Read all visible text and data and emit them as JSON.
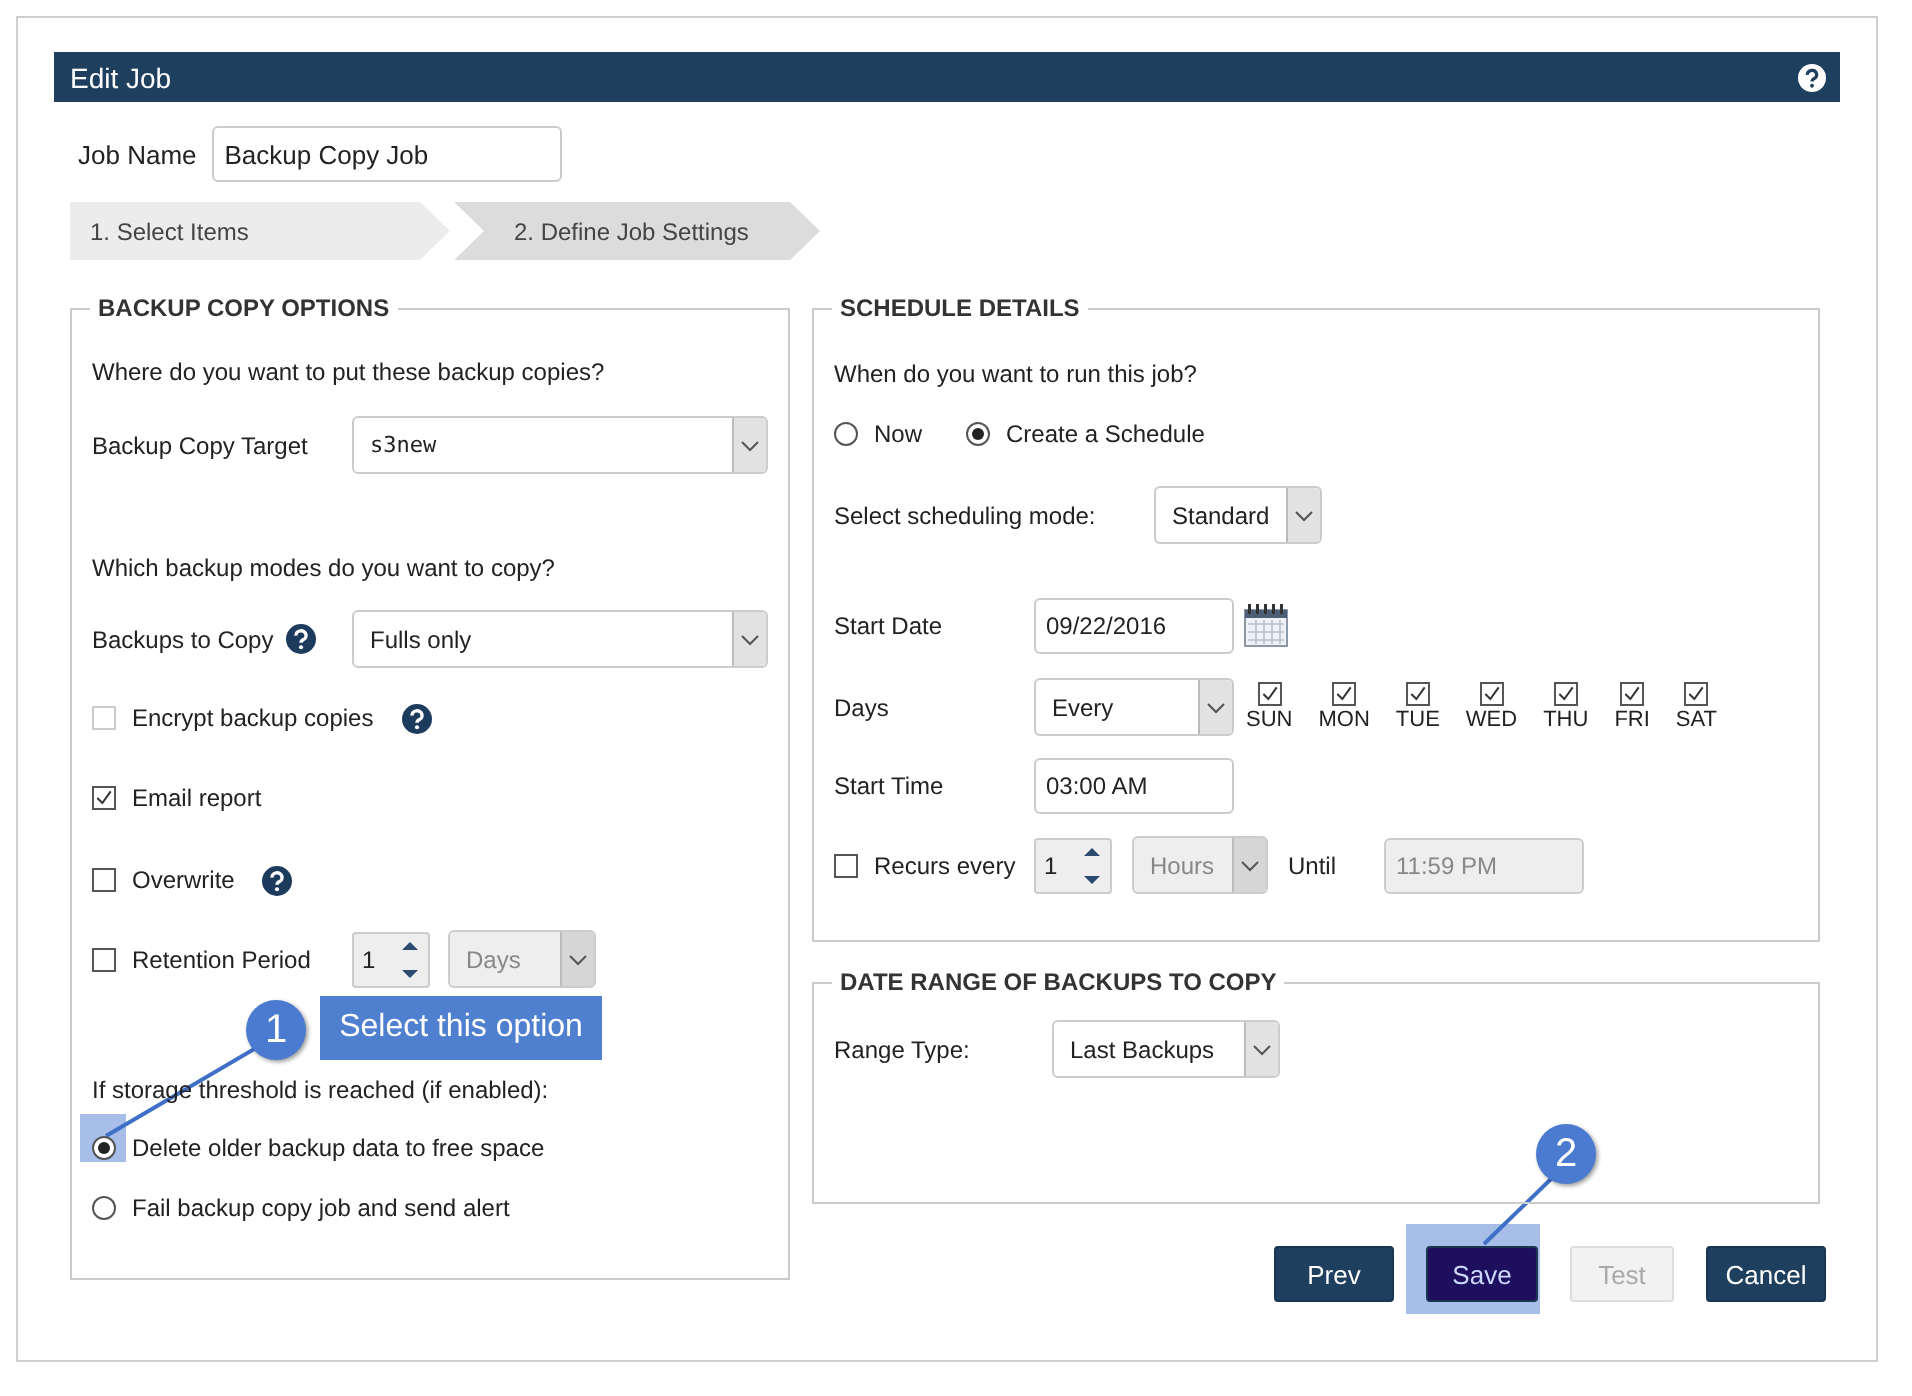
{
  "dialog": {
    "title": "Edit Job"
  },
  "job_name": {
    "label": "Job Name",
    "value": "Backup Copy Job"
  },
  "steps": [
    {
      "label": "1. Select Items",
      "selected": false
    },
    {
      "label": "2. Define Job Settings",
      "selected": true
    }
  ],
  "backup_copy_options": {
    "title": "BACKUP COPY OPTIONS",
    "target_question": "Where do you want to put these backup copies?",
    "target": {
      "label": "Backup Copy Target",
      "value": "s3new"
    },
    "modes_question": "Which backup modes do you want to copy?",
    "backups_to_copy": {
      "label": "Backups to Copy",
      "value": "Fulls only",
      "help": true
    },
    "options": [
      {
        "kind": "checkbox",
        "label": "Encrypt backup copies",
        "checked": false,
        "disabled": true,
        "help": true
      },
      {
        "kind": "checkbox",
        "label": "Email report",
        "checked": true,
        "disabled": false,
        "help": false
      },
      {
        "kind": "checkbox",
        "label": "Overwrite",
        "checked": false,
        "disabled": false,
        "help": true
      },
      {
        "kind": "retention",
        "label": "Retention Period",
        "checked": false,
        "disabled": false,
        "help": false,
        "count": "1",
        "unit": "Days"
      }
    ],
    "threshold_label": "If storage threshold is reached (if enabled):",
    "threshold_choices": [
      {
        "label": "Delete older backup data to free space",
        "selected": true
      },
      {
        "label": "Fail backup copy job and send alert",
        "selected": false
      }
    ]
  },
  "schedule": {
    "title": "SCHEDULE DETAILS",
    "question": "When do you want to run this job?",
    "run": [
      {
        "label": "Now",
        "selected": false
      },
      {
        "label": "Create a Schedule",
        "selected": true
      }
    ],
    "mode": {
      "label": "Select scheduling mode:",
      "value": "Standard"
    },
    "start_date": {
      "label": "Start Date",
      "value": "09/22/2016"
    },
    "days": {
      "label": "Days",
      "value": "Every",
      "weekdays": [
        {
          "label": "SUN",
          "checked": true
        },
        {
          "label": "MON",
          "checked": true
        },
        {
          "label": "TUE",
          "checked": true
        },
        {
          "label": "WED",
          "checked": true
        },
        {
          "label": "THU",
          "checked": true
        },
        {
          "label": "FRI",
          "checked": true
        },
        {
          "label": "SAT",
          "checked": true
        }
      ]
    },
    "start_time": {
      "label": "Start Time",
      "value": "03:00 AM"
    },
    "recurs": {
      "label": "Recurs every",
      "checked": false,
      "count": "1",
      "unit": "Hours",
      "until_label": "Until",
      "until": "11:59 PM"
    }
  },
  "date_range": {
    "title": "DATE RANGE OF BACKUPS TO COPY",
    "label": "Range Type:",
    "value": "Last Backups"
  },
  "buttons": [
    {
      "label": "Prev",
      "kind": "primary"
    },
    {
      "label": "Save",
      "kind": "active"
    },
    {
      "label": "Test",
      "kind": "disabled"
    },
    {
      "label": "Cancel",
      "kind": "primary"
    }
  ],
  "callouts": [
    {
      "number": "1",
      "text": "Select this option"
    },
    {
      "number": "2"
    }
  ]
}
